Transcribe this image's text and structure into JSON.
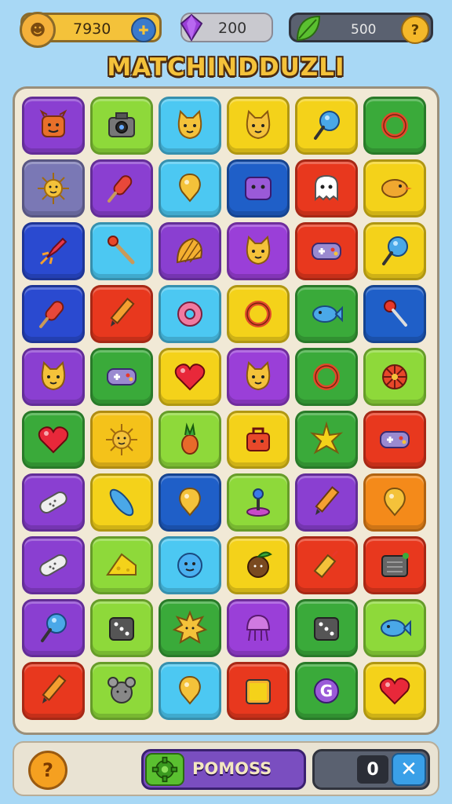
{
  "header": {
    "coins": {
      "value": "7930",
      "icon": "lion-icon",
      "action": "add-icon"
    },
    "gems": {
      "value": "200",
      "icon": "gem-icon"
    },
    "energy": {
      "value": "500",
      "icon": "leaf-icon",
      "badge": "?"
    },
    "title": "MATCHINDDUZLI"
  },
  "board": {
    "rows": [
      [
        {
          "color": "#8a3fd1",
          "icon": "monster-icon"
        },
        {
          "color": "#8ed93a",
          "icon": "camera-icon"
        },
        {
          "color": "#4cc8f2",
          "icon": "cat-face-icon"
        },
        {
          "color": "#f4d21a",
          "icon": "cat-face-icon"
        },
        {
          "color": "#f4d21a",
          "icon": "lollipop-icon"
        },
        {
          "color": "#3aaa3a",
          "icon": "ring-icon"
        }
      ],
      [
        {
          "color": "#7a78b5",
          "icon": "sun-icon"
        },
        {
          "color": "#8a3fd1",
          "icon": "popsicle-icon"
        },
        {
          "color": "#4cc8f2",
          "icon": "balloon-icon"
        },
        {
          "color": "#1f5fc8",
          "icon": "box-face-icon"
        },
        {
          "color": "#e8381e",
          "icon": "ghost-icon"
        },
        {
          "color": "#f4d21a",
          "icon": "bird-icon"
        }
      ],
      [
        {
          "color": "#2a4ad0",
          "icon": "rocket-icon"
        },
        {
          "color": "#4cc8f2",
          "icon": "match-icon"
        },
        {
          "color": "#8a3fd1",
          "icon": "shell-icon"
        },
        {
          "color": "#9a3fd8",
          "icon": "cat-face-icon"
        },
        {
          "color": "#e8381e",
          "icon": "gamepad-icon"
        },
        {
          "color": "#f4d21a",
          "icon": "lollipop-icon"
        }
      ],
      [
        {
          "color": "#2a4ad0",
          "icon": "popsicle-icon"
        },
        {
          "color": "#e8381e",
          "icon": "pencil-icon"
        },
        {
          "color": "#4cc8f2",
          "icon": "donut-icon"
        },
        {
          "color": "#f4d21a",
          "icon": "ring-icon"
        },
        {
          "color": "#3aaa3a",
          "icon": "fish-icon"
        },
        {
          "color": "#1f5fc8",
          "icon": "pin-icon"
        }
      ],
      [
        {
          "color": "#8a3fd1",
          "icon": "cat-face-icon"
        },
        {
          "color": "#3aaa3a",
          "icon": "gamepad-icon"
        },
        {
          "color": "#f4d21a",
          "icon": "heart-icon"
        },
        {
          "color": "#9a3fd8",
          "icon": "cat-face-icon"
        },
        {
          "color": "#3aaa3a",
          "icon": "ring-icon"
        },
        {
          "color": "#8ed93a",
          "icon": "wheel-icon"
        }
      ],
      [
        {
          "color": "#3aaa3a",
          "icon": "heart-icon"
        },
        {
          "color": "#f4c21a",
          "icon": "sun-icon"
        },
        {
          "color": "#8ed93a",
          "icon": "pineapple-icon"
        },
        {
          "color": "#f4d21a",
          "icon": "bag-icon"
        },
        {
          "color": "#3aaa3a",
          "icon": "star-burst-icon"
        },
        {
          "color": "#e8381e",
          "icon": "gamepad-icon"
        }
      ],
      [
        {
          "color": "#8a3fd1",
          "icon": "bandage-icon"
        },
        {
          "color": "#f4d21a",
          "icon": "surfboard-icon"
        },
        {
          "color": "#1f5fc8",
          "icon": "balloon-icon"
        },
        {
          "color": "#8ed93a",
          "icon": "joystick-icon"
        },
        {
          "color": "#8a3fd1",
          "icon": "pencil-icon"
        },
        {
          "color": "#f48a1a",
          "icon": "balloon-icon"
        }
      ],
      [
        {
          "color": "#8a3fd1",
          "icon": "bandage-icon"
        },
        {
          "color": "#8ed93a",
          "icon": "cheese-icon"
        },
        {
          "color": "#4cc8f2",
          "icon": "cloud-face-icon"
        },
        {
          "color": "#f4d21a",
          "icon": "coconut-icon"
        },
        {
          "color": "#e8381e",
          "icon": "firecracker-icon"
        },
        {
          "color": "#e8381e",
          "icon": "chip-icon"
        }
      ],
      [
        {
          "color": "#8a3fd1",
          "icon": "lollipop-icon"
        },
        {
          "color": "#8ed93a",
          "icon": "dice-icon"
        },
        {
          "color": "#3aaa3a",
          "icon": "sun-face-icon"
        },
        {
          "color": "#9a3fd8",
          "icon": "jellyfish-icon"
        },
        {
          "color": "#3aaa3a",
          "icon": "dice-icon"
        },
        {
          "color": "#8ed93a",
          "icon": "fish-icon"
        }
      ],
      [
        {
          "color": "#e8381e",
          "icon": "pencil-icon"
        },
        {
          "color": "#8ed93a",
          "icon": "mouse-icon"
        },
        {
          "color": "#4cc8f2",
          "icon": "balloon-icon"
        },
        {
          "color": "#e8381e",
          "icon": "toast-icon"
        },
        {
          "color": "#3aaa3a",
          "icon": "g-coin-icon"
        },
        {
          "color": "#f4d21a",
          "icon": "heart-icon"
        }
      ]
    ]
  },
  "footer": {
    "hint_label": "?",
    "power_label": "POMOSS",
    "power_icon": "gear-icon",
    "score_value": "0",
    "close_label": "✕"
  }
}
